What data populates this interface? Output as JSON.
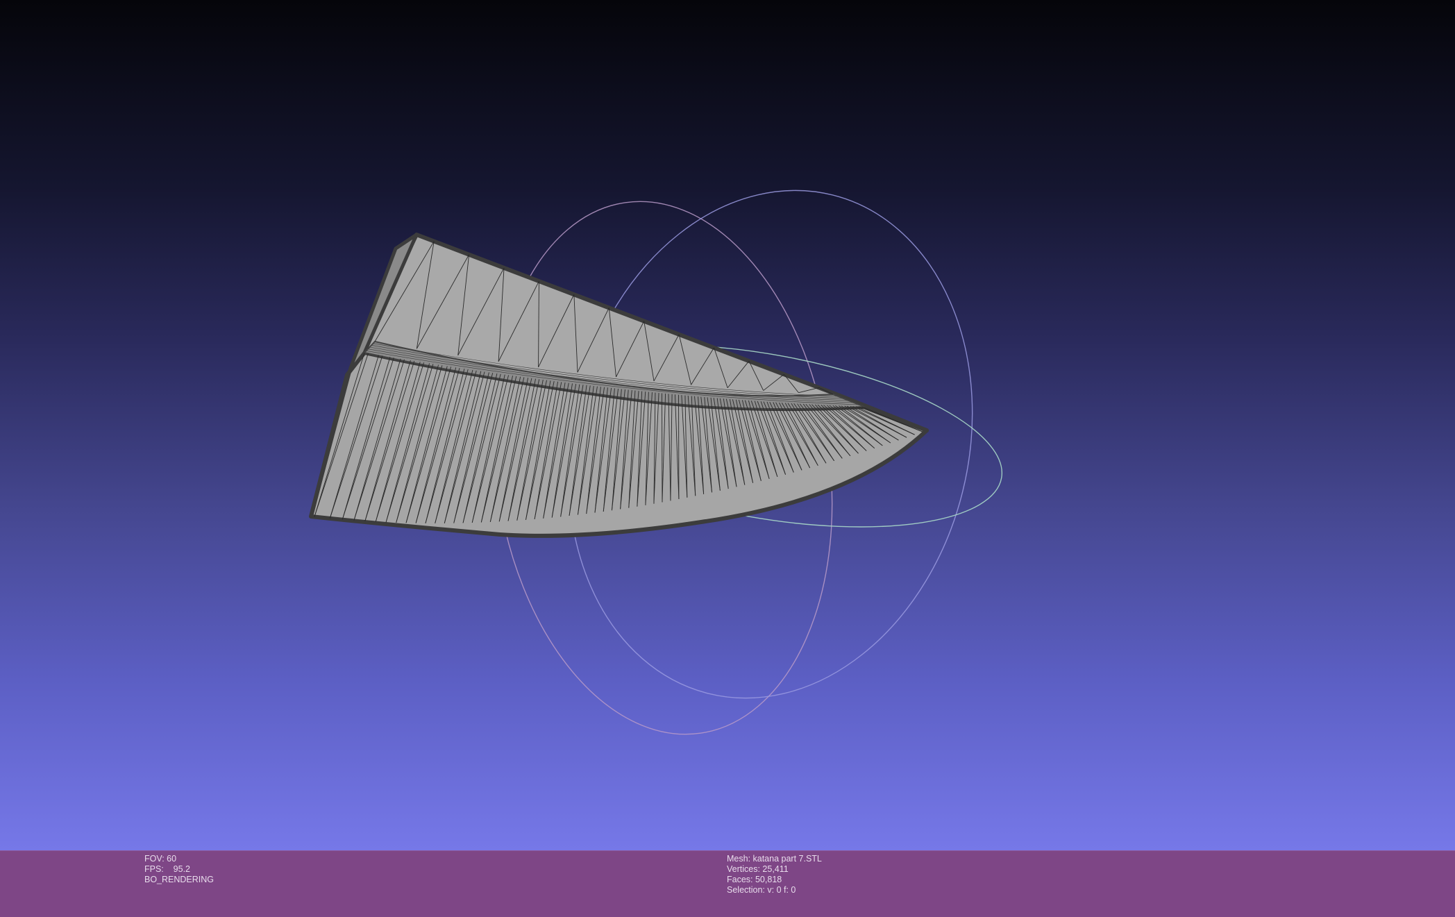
{
  "viewport": {
    "background_top": "#05050a",
    "background_bottom": "#7678e8",
    "mesh_fill": "#a8a8a8",
    "mesh_edge": "#3a3a3a",
    "wire_color": "#2a2a2a",
    "trackball_colors": [
      "#c8a0c8",
      "#a0a0e0",
      "#a0e0c0"
    ]
  },
  "info_bar": {
    "background": "#7e4686",
    "left": {
      "fov": "FOV: 60",
      "fps": "FPS:    95.2",
      "render_mode": "BO_RENDERING"
    },
    "right": {
      "mesh": "Mesh: katana part 7.STL",
      "vertices": "Vertices: 25,411",
      "faces": "Faces: 50,818",
      "selection": "Selection: v: 0 f: 0"
    }
  }
}
